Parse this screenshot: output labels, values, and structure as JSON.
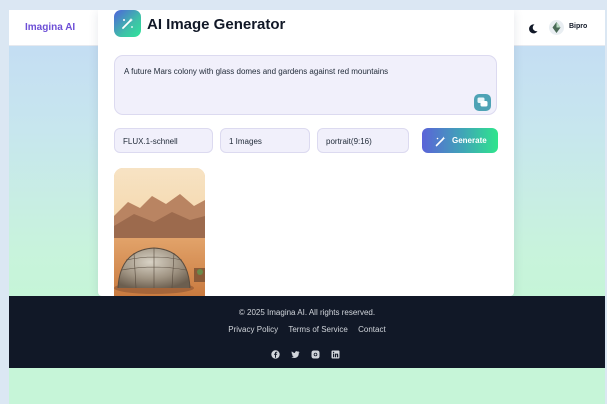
{
  "navbar": {
    "brand": "Imagina AI",
    "theme_icon": "moon-icon",
    "user": {
      "name": "Bipro",
      "avatar_icon": "avatar-icon"
    }
  },
  "generator": {
    "title": "AI Image Generator",
    "logo_icon": "magic-wand-icon",
    "prompt_value": "A future Mars colony with glass domes and gardens against red mountains",
    "prompt_action_icon": "chat-bubbles-icon",
    "model": {
      "selected": "FLUX.1-schnell"
    },
    "count": {
      "selected": "1 Images"
    },
    "aspect": {
      "selected": "portrait(9:16)"
    },
    "generate_label": "Generate",
    "generate_icon": "magic-wand-icon"
  },
  "results": [
    {
      "thumbnail": "mars-colony-dome-image"
    }
  ],
  "footer": {
    "copyright": "© 2025 Imagina AI. All rights reserved.",
    "links": [
      "Privacy Policy",
      "Terms of Service",
      "Contact"
    ],
    "socials": [
      "facebook-icon",
      "twitter-icon",
      "instagram-icon",
      "linkedin-icon"
    ]
  },
  "colors": {
    "brand": "#6d4fd6",
    "footer_bg": "#111827",
    "gradient_start": "#5b63d8",
    "gradient_end": "#2fe58c",
    "field_bg": "#f1f0fb"
  }
}
